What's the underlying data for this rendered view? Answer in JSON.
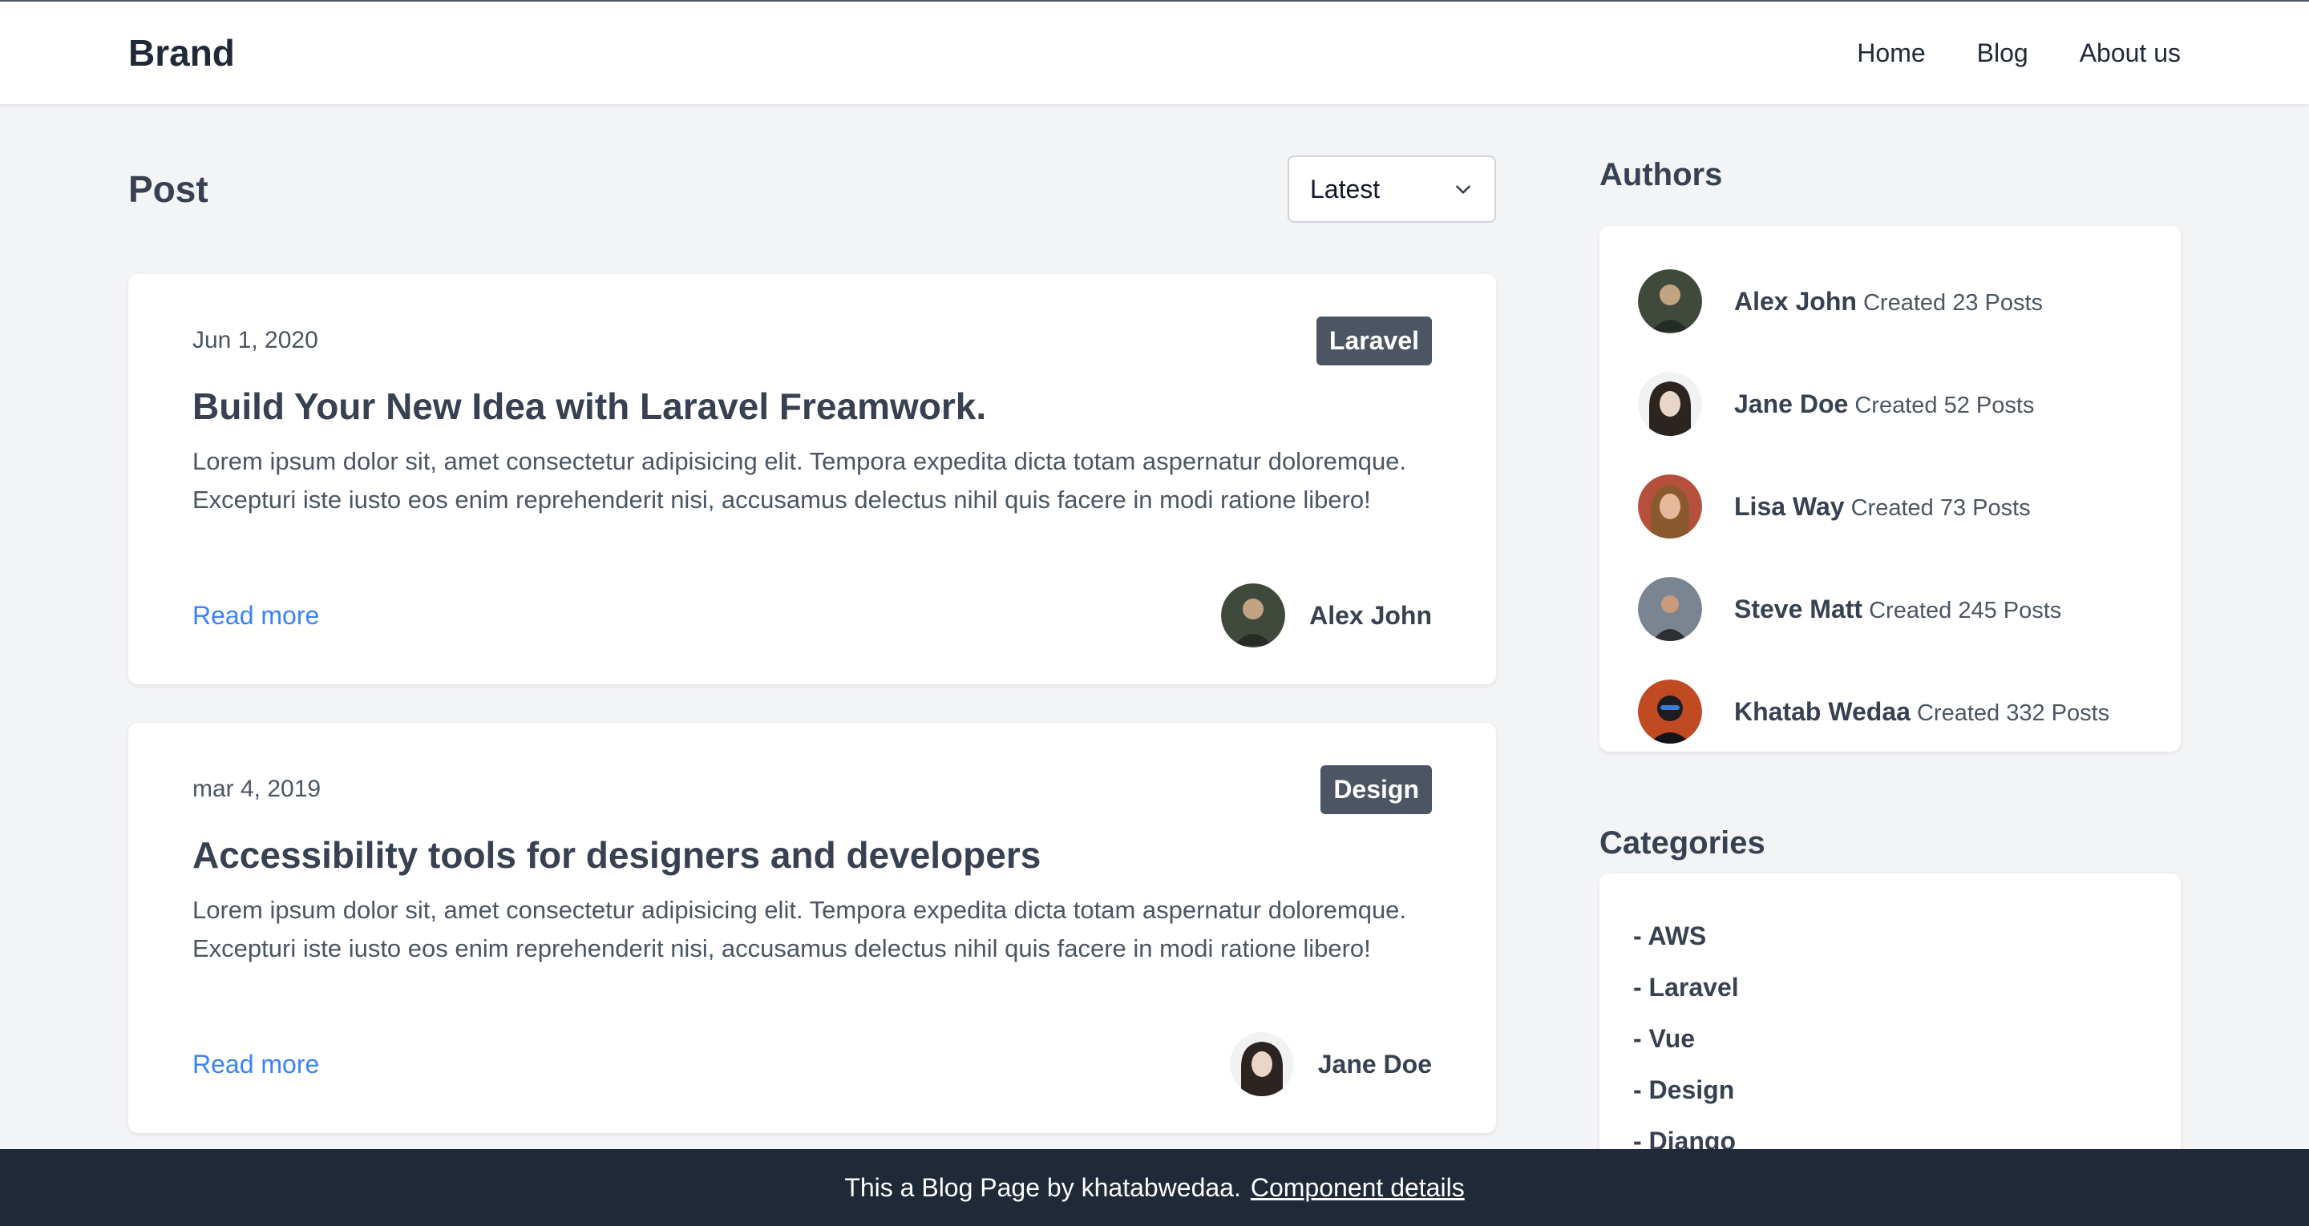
{
  "nav": {
    "brand": "Brand",
    "links": [
      "Home",
      "Blog",
      "About us"
    ]
  },
  "main": {
    "title": "Post",
    "sort": {
      "selected": "Latest"
    }
  },
  "posts": [
    {
      "date": "Jun 1, 2020",
      "category": "Laravel",
      "title": "Build Your New Idea with Laravel Freamwork.",
      "excerpt": "Lorem ipsum dolor sit, amet consectetur adipisicing elit. Tempora expedita dicta totam aspernatur doloremque. Excepturi iste iusto eos enim reprehenderit nisi, accusamus delectus nihil quis facere in modi ratione libero!",
      "read_more": "Read more",
      "author": "Alex John",
      "avatar_color": "#3f4a3c"
    },
    {
      "date": "mar 4, 2019",
      "category": "Design",
      "title": "Accessibility tools for designers and developers",
      "excerpt": "Lorem ipsum dolor sit, amet consectetur adipisicing elit. Tempora expedita dicta totam aspernatur doloremque. Excepturi iste iusto eos enim reprehenderit nisi, accusamus delectus nihil quis facere in modi ratione libero!",
      "read_more": "Read more",
      "author": "Jane Doe",
      "avatar_color": "#2b2420"
    }
  ],
  "sidebar": {
    "authors_title": "Authors",
    "authors": [
      {
        "name": "Alex John",
        "posts": "Created 23 Posts",
        "avatar_color": "#3f4a3c"
      },
      {
        "name": "Jane Doe",
        "posts": "Created 52 Posts",
        "avatar_color": "#2b2420"
      },
      {
        "name": "Lisa Way",
        "posts": "Created 73 Posts",
        "avatar_color": "#b5503c"
      },
      {
        "name": "Steve Matt",
        "posts": "Created 245 Posts",
        "avatar_color": "#7a8591"
      },
      {
        "name": "Khatab Wedaa",
        "posts": "Created 332 Posts",
        "avatar_color": "#c04a22"
      }
    ],
    "categories_title": "Categories",
    "categories": [
      "- AWS",
      "- Laravel",
      "- Vue",
      "- Design",
      "- Django"
    ]
  },
  "footer": {
    "text": "This a Blog Page by khatabwedaa.",
    "link": "Component details"
  },
  "colors": {
    "accent": "#3b82f6",
    "badge": "#4b5563",
    "footer_bg": "#1f2937",
    "page_bg": "#f3f4f6"
  }
}
